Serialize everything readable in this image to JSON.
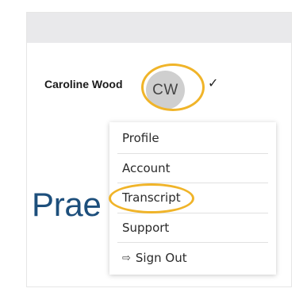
{
  "header": {
    "user_name": "Caroline Wood",
    "avatar_initials": "CW"
  },
  "page": {
    "heading_fragment": "Prae"
  },
  "menu": {
    "items": [
      {
        "label": "Profile"
      },
      {
        "label": "Account"
      },
      {
        "label": "Transcript"
      },
      {
        "label": "Support"
      },
      {
        "label": "Sign Out",
        "icon": "sign-out-icon"
      }
    ]
  },
  "colors": {
    "highlight_ring": "#f0b429",
    "heading_blue": "#1d4f7c",
    "topbar": "#e9e9eb"
  }
}
